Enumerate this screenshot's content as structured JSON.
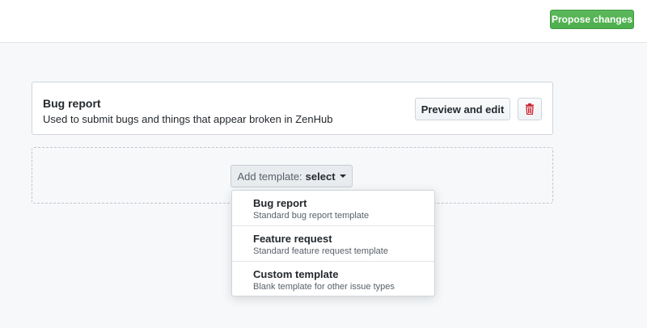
{
  "header": {
    "propose_label": "Propose changes",
    "propose_color": "#5cb85c"
  },
  "template_card": {
    "title": "Bug report",
    "description": "Used to submit bugs and things that appear broken in ZenHub",
    "preview_label": "Preview and edit",
    "delete_icon": "trash-icon",
    "delete_color": "#cb2431"
  },
  "add_template": {
    "prefix": "Add template:",
    "selected": "select",
    "icon": "caret-down-icon"
  },
  "dropdown": {
    "items": [
      {
        "title": "Bug report",
        "description": "Standard bug report template"
      },
      {
        "title": "Feature request",
        "description": "Standard feature request template"
      },
      {
        "title": "Custom template",
        "description": "Blank template for other issue types"
      }
    ]
  }
}
